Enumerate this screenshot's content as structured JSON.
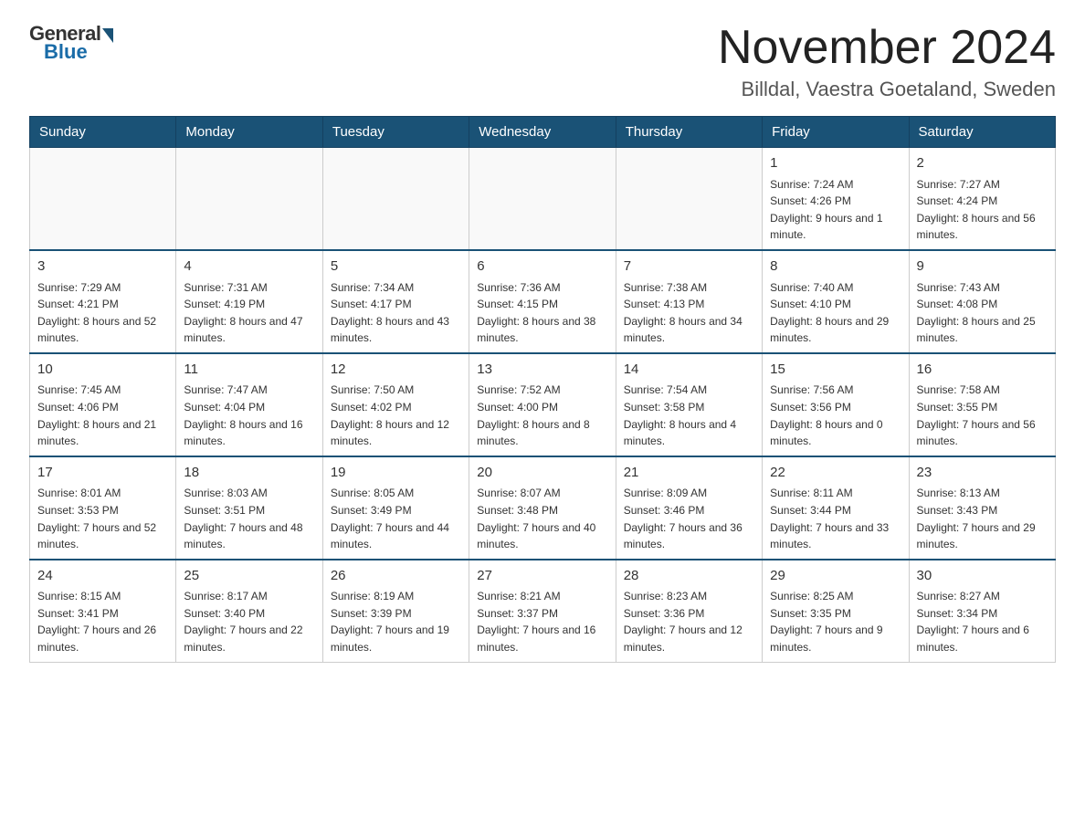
{
  "logo": {
    "general": "General",
    "blue": "Blue"
  },
  "header": {
    "month": "November 2024",
    "location": "Billdal, Vaestra Goetaland, Sweden"
  },
  "days_of_week": [
    "Sunday",
    "Monday",
    "Tuesday",
    "Wednesday",
    "Thursday",
    "Friday",
    "Saturday"
  ],
  "weeks": [
    [
      {
        "day": "",
        "info": ""
      },
      {
        "day": "",
        "info": ""
      },
      {
        "day": "",
        "info": ""
      },
      {
        "day": "",
        "info": ""
      },
      {
        "day": "",
        "info": ""
      },
      {
        "day": "1",
        "info": "Sunrise: 7:24 AM\nSunset: 4:26 PM\nDaylight: 9 hours and 1 minute."
      },
      {
        "day": "2",
        "info": "Sunrise: 7:27 AM\nSunset: 4:24 PM\nDaylight: 8 hours and 56 minutes."
      }
    ],
    [
      {
        "day": "3",
        "info": "Sunrise: 7:29 AM\nSunset: 4:21 PM\nDaylight: 8 hours and 52 minutes."
      },
      {
        "day": "4",
        "info": "Sunrise: 7:31 AM\nSunset: 4:19 PM\nDaylight: 8 hours and 47 minutes."
      },
      {
        "day": "5",
        "info": "Sunrise: 7:34 AM\nSunset: 4:17 PM\nDaylight: 8 hours and 43 minutes."
      },
      {
        "day": "6",
        "info": "Sunrise: 7:36 AM\nSunset: 4:15 PM\nDaylight: 8 hours and 38 minutes."
      },
      {
        "day": "7",
        "info": "Sunrise: 7:38 AM\nSunset: 4:13 PM\nDaylight: 8 hours and 34 minutes."
      },
      {
        "day": "8",
        "info": "Sunrise: 7:40 AM\nSunset: 4:10 PM\nDaylight: 8 hours and 29 minutes."
      },
      {
        "day": "9",
        "info": "Sunrise: 7:43 AM\nSunset: 4:08 PM\nDaylight: 8 hours and 25 minutes."
      }
    ],
    [
      {
        "day": "10",
        "info": "Sunrise: 7:45 AM\nSunset: 4:06 PM\nDaylight: 8 hours and 21 minutes."
      },
      {
        "day": "11",
        "info": "Sunrise: 7:47 AM\nSunset: 4:04 PM\nDaylight: 8 hours and 16 minutes."
      },
      {
        "day": "12",
        "info": "Sunrise: 7:50 AM\nSunset: 4:02 PM\nDaylight: 8 hours and 12 minutes."
      },
      {
        "day": "13",
        "info": "Sunrise: 7:52 AM\nSunset: 4:00 PM\nDaylight: 8 hours and 8 minutes."
      },
      {
        "day": "14",
        "info": "Sunrise: 7:54 AM\nSunset: 3:58 PM\nDaylight: 8 hours and 4 minutes."
      },
      {
        "day": "15",
        "info": "Sunrise: 7:56 AM\nSunset: 3:56 PM\nDaylight: 8 hours and 0 minutes."
      },
      {
        "day": "16",
        "info": "Sunrise: 7:58 AM\nSunset: 3:55 PM\nDaylight: 7 hours and 56 minutes."
      }
    ],
    [
      {
        "day": "17",
        "info": "Sunrise: 8:01 AM\nSunset: 3:53 PM\nDaylight: 7 hours and 52 minutes."
      },
      {
        "day": "18",
        "info": "Sunrise: 8:03 AM\nSunset: 3:51 PM\nDaylight: 7 hours and 48 minutes."
      },
      {
        "day": "19",
        "info": "Sunrise: 8:05 AM\nSunset: 3:49 PM\nDaylight: 7 hours and 44 minutes."
      },
      {
        "day": "20",
        "info": "Sunrise: 8:07 AM\nSunset: 3:48 PM\nDaylight: 7 hours and 40 minutes."
      },
      {
        "day": "21",
        "info": "Sunrise: 8:09 AM\nSunset: 3:46 PM\nDaylight: 7 hours and 36 minutes."
      },
      {
        "day": "22",
        "info": "Sunrise: 8:11 AM\nSunset: 3:44 PM\nDaylight: 7 hours and 33 minutes."
      },
      {
        "day": "23",
        "info": "Sunrise: 8:13 AM\nSunset: 3:43 PM\nDaylight: 7 hours and 29 minutes."
      }
    ],
    [
      {
        "day": "24",
        "info": "Sunrise: 8:15 AM\nSunset: 3:41 PM\nDaylight: 7 hours and 26 minutes."
      },
      {
        "day": "25",
        "info": "Sunrise: 8:17 AM\nSunset: 3:40 PM\nDaylight: 7 hours and 22 minutes."
      },
      {
        "day": "26",
        "info": "Sunrise: 8:19 AM\nSunset: 3:39 PM\nDaylight: 7 hours and 19 minutes."
      },
      {
        "day": "27",
        "info": "Sunrise: 8:21 AM\nSunset: 3:37 PM\nDaylight: 7 hours and 16 minutes."
      },
      {
        "day": "28",
        "info": "Sunrise: 8:23 AM\nSunset: 3:36 PM\nDaylight: 7 hours and 12 minutes."
      },
      {
        "day": "29",
        "info": "Sunrise: 8:25 AM\nSunset: 3:35 PM\nDaylight: 7 hours and 9 minutes."
      },
      {
        "day": "30",
        "info": "Sunrise: 8:27 AM\nSunset: 3:34 PM\nDaylight: 7 hours and 6 minutes."
      }
    ]
  ]
}
